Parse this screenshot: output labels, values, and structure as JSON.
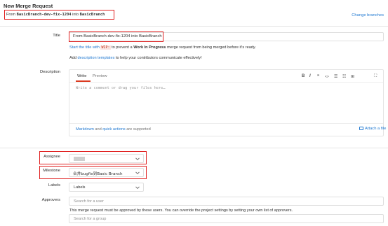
{
  "page": {
    "title": "New Merge Request",
    "change_branches": "Change branches"
  },
  "branch_line": {
    "prefix": "From",
    "source": "BasicBranch-dev-fix-1204",
    "middle": "into",
    "target": "BasicBranch"
  },
  "title_field": {
    "label": "Title",
    "value": "From BasicBranch-dev-fix-1204 into BasicBranch",
    "hint_prefix": "Start the title with",
    "hint_code": "WIP:",
    "hint_mid": "to prevent a",
    "hint_bold": "Work In Progress",
    "hint_suffix": "merge request from being merged before it's ready.",
    "templates_prefix": "Add",
    "templates_link": "description templates",
    "templates_suffix": "to help your contributors communicate effectively!"
  },
  "description": {
    "label": "Description",
    "tab_write": "Write",
    "tab_preview": "Preview",
    "placeholder": "Write a comment or drag your files here…",
    "footer_markdown": "Markdown",
    "footer_and": "and",
    "footer_quick": "quick actions",
    "footer_supported": "are supported",
    "attach": "Attach a file",
    "toolbar": {
      "bold": "B",
      "italic": "I",
      "quote": "❞",
      "code": "<>",
      "ul": "☰",
      "ol": "☷",
      "table": "⊞",
      "fullscreen": "⛶"
    }
  },
  "assignee": {
    "label": "Assignee",
    "value": ""
  },
  "milestone": {
    "label": "Milestone",
    "value": "合并bugfix到Basic Branch"
  },
  "labels": {
    "label": "Labels",
    "value": "Labels"
  },
  "approvers": {
    "label": "Approvers",
    "user_placeholder": "Search for a user",
    "help": "This merge request must be approved by these users. You can override the project settings by setting your own list of approvers.",
    "group_placeholder": "Search for a group"
  },
  "colors": {
    "link": "#1f78d1",
    "highlight_box": "#e02020",
    "border": "#dfdfdf"
  }
}
